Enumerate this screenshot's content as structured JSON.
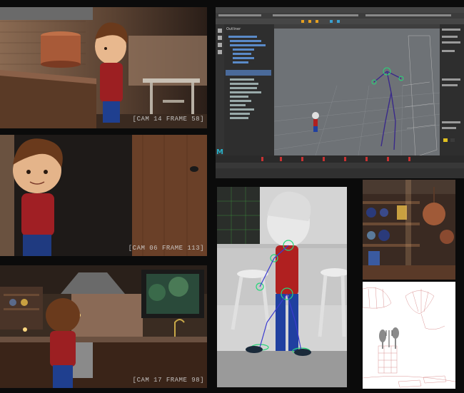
{
  "frames": [
    {
      "id": "cam14",
      "label": "[CAM 14 FRAME 58]"
    },
    {
      "id": "cam06",
      "label": "[CAM 06 FRAME 113]"
    },
    {
      "id": "cam17",
      "label": "[CAM 17 FRAME 98]"
    }
  ],
  "maya": {
    "logo": "M",
    "outliner_title": "Outliner",
    "palette": {
      "bg": "#3a3a3a",
      "viewport": "#6e7276",
      "timeline_key": "#c83232",
      "bone": "#3a2a8a",
      "ctrl": "#27d67a"
    }
  },
  "colors": {
    "wall_brick": "#7a5a44",
    "wood": "#3a2418",
    "shirt": "#9c1f22",
    "jeans": "#1f3f8f",
    "hair": "#6a3a1c",
    "skin": "#e8b88e"
  }
}
